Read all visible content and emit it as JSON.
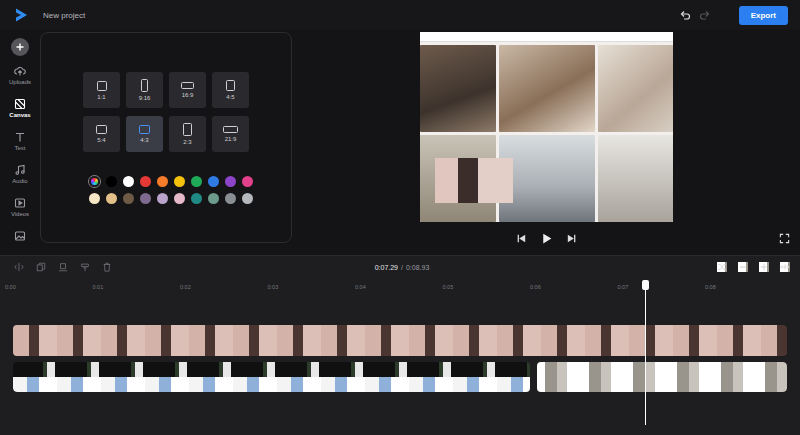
{
  "header": {
    "title": "New project",
    "export": "Export"
  },
  "sidebar": {
    "items": [
      {
        "label": "Uploads",
        "selected": false
      },
      {
        "label": "Canvas",
        "selected": true
      },
      {
        "label": "Text",
        "selected": false
      },
      {
        "label": "Audio",
        "selected": false
      },
      {
        "label": "Videos",
        "selected": false
      }
    ]
  },
  "canvas_panel": {
    "ratios": [
      {
        "label": "1:1",
        "selected": false
      },
      {
        "label": "9:16",
        "selected": false
      },
      {
        "label": "16:9",
        "selected": false
      },
      {
        "label": "4:5",
        "selected": false
      },
      {
        "label": "5:4",
        "selected": false
      },
      {
        "label": "4:3",
        "selected": true
      },
      {
        "label": "2:3",
        "selected": false
      },
      {
        "label": "21:9",
        "selected": false
      }
    ],
    "colors": [
      {
        "kind": "picker"
      },
      {
        "kind": "swatch",
        "color": "#000000"
      },
      {
        "kind": "swatch",
        "color": "#ffffff"
      },
      {
        "kind": "swatch",
        "color": "#e53935"
      },
      {
        "kind": "swatch",
        "color": "#f57c2a"
      },
      {
        "kind": "swatch",
        "color": "#f4c20d"
      },
      {
        "kind": "swatch",
        "color": "#1faa59"
      },
      {
        "kind": "swatch",
        "color": "#2f7be5"
      },
      {
        "kind": "swatch",
        "color": "#8e44c9"
      },
      {
        "kind": "swatch",
        "color": "#e0418a"
      },
      {
        "kind": "swatch",
        "color": "#f5e6c4"
      },
      {
        "kind": "swatch",
        "color": "#e3c08a"
      },
      {
        "kind": "swatch",
        "color": "#6e5a45"
      },
      {
        "kind": "swatch",
        "color": "#7e6a8e"
      },
      {
        "kind": "swatch",
        "color": "#b9a3c9"
      },
      {
        "kind": "swatch",
        "color": "#e6b8c8"
      },
      {
        "kind": "swatch",
        "color": "#1f8a84"
      },
      {
        "kind": "swatch",
        "color": "#6c9a8b"
      },
      {
        "kind": "swatch",
        "color": "#8a8f93"
      },
      {
        "kind": "swatch",
        "color": "#b5b9bd"
      }
    ]
  },
  "player": {
    "playing": false
  },
  "timeline": {
    "current": "0:07.29",
    "separator": "/",
    "total": "0:08.93",
    "ruler": [
      "0:00",
      "0:01",
      "0:02",
      "0:03",
      "0:04",
      "0:05",
      "0:06",
      "0:07",
      "0:08"
    ],
    "playhead": {
      "level": 0.816
    }
  }
}
